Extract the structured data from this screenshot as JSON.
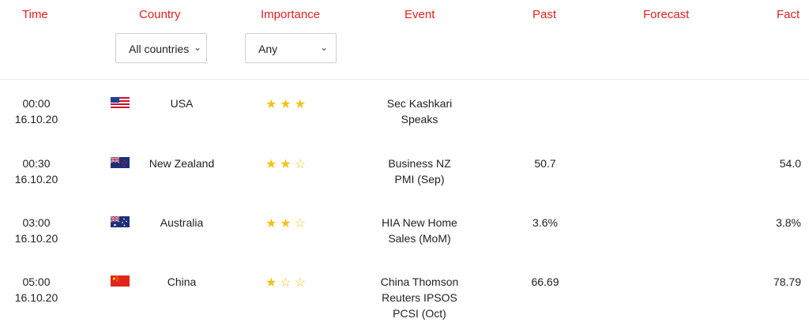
{
  "headers": {
    "time": "Time",
    "country": "Country",
    "importance": "Importance",
    "event": "Event",
    "past": "Past",
    "forecast": "Forecast",
    "fact": "Fact"
  },
  "filters": {
    "country": {
      "value": "All countries",
      "icon": "chevron-down-icon"
    },
    "importance": {
      "value": "Any",
      "icon": "chevron-down-icon"
    }
  },
  "colors": {
    "header": "#e0211f",
    "star": "#f3c31a"
  },
  "rows": [
    {
      "time": "00:00",
      "date": "16.10.20",
      "flag": "usa",
      "country": "USA",
      "importance": 3,
      "stars": "★★★",
      "event_line1": "Sec Kashkari",
      "event_line2": "Speaks",
      "event_line3": "",
      "past": "",
      "forecast": "",
      "fact": ""
    },
    {
      "time": "00:30",
      "date": "16.10.20",
      "flag": "new-zealand",
      "country": "New Zealand",
      "importance": 2,
      "stars": "★★☆",
      "event_line1": "Business NZ",
      "event_line2": "PMI (Sep)",
      "event_line3": "",
      "past": "50.7",
      "forecast": "",
      "fact": "54.0"
    },
    {
      "time": "03:00",
      "date": "16.10.20",
      "flag": "australia",
      "country": "Australia",
      "importance": 2,
      "stars": "★★☆",
      "event_line1": "HIA New Home",
      "event_line2": "Sales (MoM)",
      "event_line3": "",
      "past": "3.6%",
      "forecast": "",
      "fact": "3.8%"
    },
    {
      "time": "05:00",
      "date": "16.10.20",
      "flag": "china",
      "country": "China",
      "importance": 1,
      "stars": "★☆☆",
      "event_line1": "China Thomson",
      "event_line2": "Reuters IPSOS",
      "event_line3": "PCSI (Oct)",
      "past": "66.69",
      "forecast": "",
      "fact": "78.79"
    }
  ]
}
